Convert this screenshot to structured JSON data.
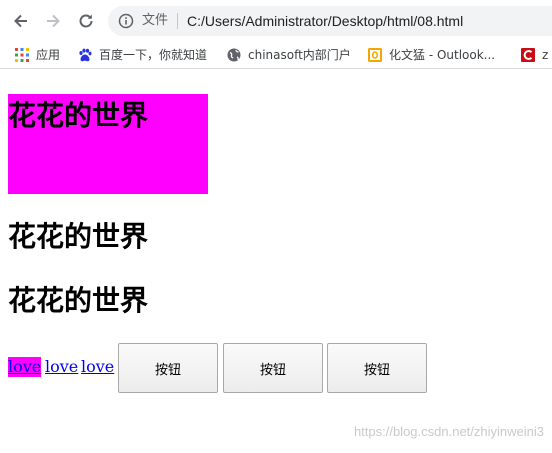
{
  "browser": {
    "file_label": "文件",
    "url": "C:/Users/Administrator/Desktop/html/08.html",
    "bookmarks": [
      {
        "label": "应用",
        "icon": "apps-grid-icon"
      },
      {
        "label": "百度一下，你就知道",
        "icon": "baidu-paw-icon"
      },
      {
        "label": "chinasoft内部门户",
        "icon": "globe-icon"
      },
      {
        "label": "化文猛 - Outlook...",
        "icon": "outlook-icon"
      },
      {
        "label": "z",
        "icon": "csdn-c-icon"
      }
    ]
  },
  "page": {
    "headings": [
      "花花的世界",
      "花花的世界",
      "花花的世界"
    ],
    "links": [
      "love",
      "love",
      "love"
    ],
    "buttons": [
      "按钮",
      "按钮",
      "按钮"
    ],
    "watermark": "https://blog.csdn.net/zhiyinweini3"
  },
  "colors": {
    "highlight": "#ff00ff",
    "link": "#0000ee"
  }
}
